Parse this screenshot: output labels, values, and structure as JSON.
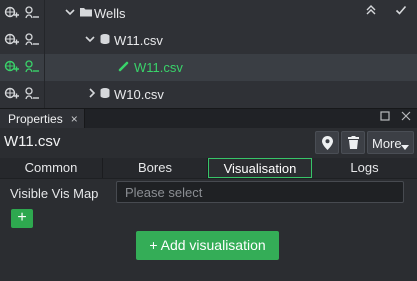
{
  "tree": {
    "rows": [
      {
        "label": "Wells",
        "tools": [
          "«",
          "✓"
        ]
      },
      {
        "label": "W11.csv"
      },
      {
        "label": "W11.csv"
      },
      {
        "label": "W10.csv"
      }
    ]
  },
  "panel": {
    "tab_label": "Properties",
    "tab_close": "×",
    "title": "W11.csv",
    "more_label": "More",
    "tabs": [
      "Common",
      "Bores",
      "Visualisation",
      "Logs"
    ],
    "active_tab": "Visualisation",
    "visible_vis_map_label": "Visible Vis Map",
    "select_placeholder": "Please select",
    "add_small_label": "+",
    "add_visualisation_label": "+ Add visualisation"
  },
  "colors": {
    "accent_green": "#34ad57",
    "highlight_green": "#39d36a",
    "bg_dark": "#2b2d31"
  }
}
